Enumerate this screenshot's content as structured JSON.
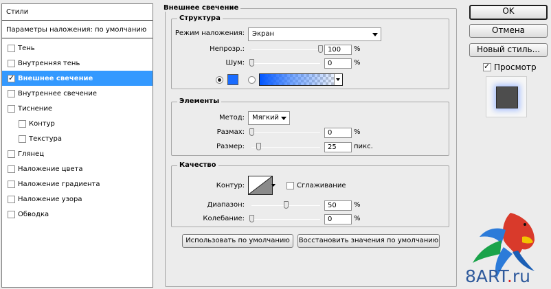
{
  "left_panel": {
    "header": "Стили",
    "blending_defaults": "Параметры наложения: по умолчанию",
    "items": [
      {
        "label": "Тень",
        "checked": false,
        "selected": false,
        "sub": false
      },
      {
        "label": "Внутренняя тень",
        "checked": false,
        "selected": false,
        "sub": false
      },
      {
        "label": "Внешнее свечение",
        "checked": true,
        "selected": true,
        "sub": false
      },
      {
        "label": "Внутреннее свечение",
        "checked": false,
        "selected": false,
        "sub": false
      },
      {
        "label": "Тиснение",
        "checked": false,
        "selected": false,
        "sub": false
      },
      {
        "label": "Контур",
        "checked": false,
        "selected": false,
        "sub": true
      },
      {
        "label": "Текстура",
        "checked": false,
        "selected": false,
        "sub": true
      },
      {
        "label": "Глянец",
        "checked": false,
        "selected": false,
        "sub": false
      },
      {
        "label": "Наложение цвета",
        "checked": false,
        "selected": false,
        "sub": false
      },
      {
        "label": "Наложение градиента",
        "checked": false,
        "selected": false,
        "sub": false
      },
      {
        "label": "Наложение узора",
        "checked": false,
        "selected": false,
        "sub": false
      },
      {
        "label": "Обводка",
        "checked": false,
        "selected": false,
        "sub": false
      }
    ]
  },
  "outer_glow": {
    "title": "Внешнее свечение",
    "structure": {
      "title": "Структура",
      "blend_mode_label": "Режим наложения:",
      "blend_mode_value": "Экран",
      "opacity_label": "Непрозр.:",
      "opacity_value": "100",
      "opacity_unit": "%",
      "opacity_level": 1.0,
      "noise_label": "Шум:",
      "noise_value": "0",
      "noise_unit": "%",
      "noise_level": 0.0,
      "color_swatch": "#1a6cff"
    },
    "elements": {
      "title": "Элементы",
      "method_label": "Метод:",
      "method_value": "Мягкий",
      "spread_label": "Размах:",
      "spread_value": "0",
      "spread_unit": "%",
      "spread_level": 0.0,
      "size_label": "Размер:",
      "size_value": "25",
      "size_unit": "пикс.",
      "size_level": 0.1
    },
    "quality": {
      "title": "Качество",
      "contour_label": "Контур:",
      "antialias_label": "Сглаживание",
      "antialias_checked": false,
      "range_label": "Диапазон:",
      "range_value": "50",
      "range_unit": "%",
      "range_level": 0.5,
      "jitter_label": "Колебание:",
      "jitter_value": "0",
      "jitter_unit": "%",
      "jitter_level": 0.0
    },
    "make_default_button": "Использовать по умолчанию",
    "reset_default_button": "Восстановить значения по умолчанию"
  },
  "right_panel": {
    "ok_button": "OK",
    "cancel_button": "Отмена",
    "new_style_button": "Новый стиль...",
    "preview_label": "Просмотр",
    "preview_checked": true
  },
  "watermark": {
    "text_main": "8ART",
    "text_dot": ".",
    "text_tld": "ru"
  }
}
